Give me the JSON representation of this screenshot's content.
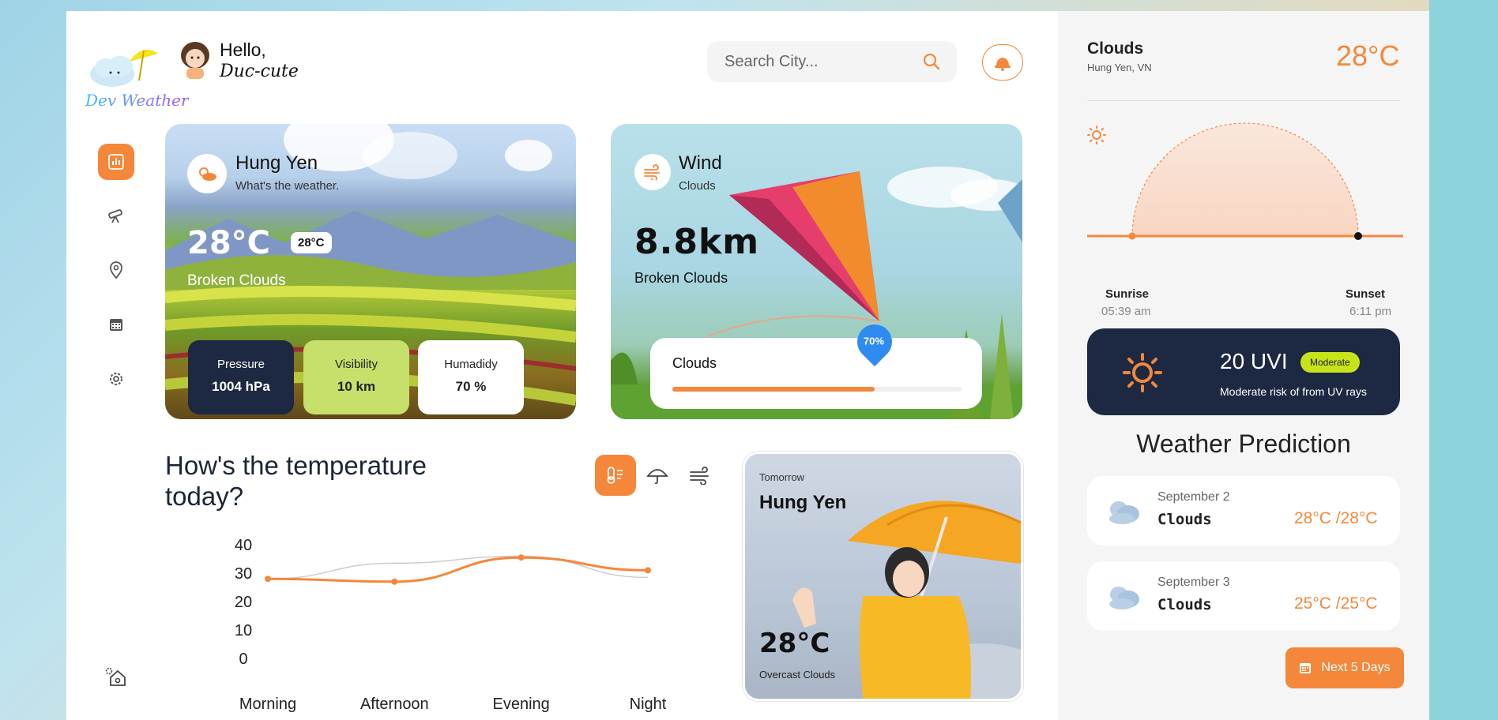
{
  "brand": {
    "logo_text": "Dev Weather"
  },
  "greeting": {
    "hello": "Hello,",
    "name": "Duc-cute"
  },
  "search": {
    "placeholder": "Search City..."
  },
  "colors": {
    "accent": "#f5873a",
    "navy": "#1d2942",
    "lime": "#c7df6b",
    "pin": "#2f8bf0"
  },
  "sidebar": {
    "items": [
      {
        "icon": "chart-icon",
        "active": true
      },
      {
        "icon": "telescope-icon",
        "active": false
      },
      {
        "icon": "location-pin-icon",
        "active": false
      },
      {
        "icon": "calendar-icon",
        "active": false
      },
      {
        "icon": "gear-icon",
        "active": false
      }
    ],
    "bottom_icon": "home-settings-icon"
  },
  "current": {
    "city": "Hung Yen",
    "subtitle": "What's the weather.",
    "temp": "28°C",
    "badge": "28°C",
    "description": "Broken Clouds",
    "stats": [
      {
        "label": "Pressure",
        "value": "1004 hPa"
      },
      {
        "label": "Visibility",
        "value": "10 km"
      },
      {
        "label": "Humadidy",
        "value": "70 %"
      }
    ]
  },
  "wind": {
    "title": "Wind",
    "subtitle": "Clouds",
    "value": "8.8km",
    "description": "Broken Clouds",
    "clouds_label": "Clouds",
    "clouds_percent": 70,
    "clouds_text": "70%"
  },
  "temperature": {
    "title": "How's the temperature today?",
    "modes": [
      "thermometer-icon",
      "umbrella-icon",
      "wind-icon"
    ],
    "active_mode": 0
  },
  "chart_data": {
    "type": "line",
    "categories": [
      "Morning",
      "Afternoon",
      "Evening",
      "Night"
    ],
    "series": [
      {
        "values": [
          28,
          27,
          35.5,
          31
        ],
        "color": "#f5873a"
      },
      {
        "values": [
          28,
          33.5,
          36,
          28.5
        ],
        "color": "#cccccc"
      }
    ],
    "yticks": [
      "40",
      "30",
      "20",
      "10",
      "0"
    ],
    "ylim": [
      0,
      40
    ],
    "grid": false
  },
  "tomorrow": {
    "label": "Tomorrow",
    "city": "Hung Yen",
    "temp": "28°C",
    "description": "Overcast Clouds"
  },
  "summary": {
    "condition": "Clouds",
    "location": "Hung Yen, VN",
    "temp": "28°C",
    "sunrise_label": "Sunrise",
    "sunrise_time": "05:39 am",
    "sunset_label": "Sunset",
    "sunset_time": "6:11 pm"
  },
  "uvi": {
    "value": "20 UVI",
    "badge": "Moderate",
    "text": "Moderate risk of from UV rays"
  },
  "prediction": {
    "title": "Weather Prediction",
    "items": [
      {
        "date": "September 2",
        "condition": "Clouds",
        "temps": "28°C /28°C"
      },
      {
        "date": "September 3",
        "condition": "Clouds",
        "temps": "25°C /25°C"
      }
    ],
    "next_label": "Next 5 Days"
  }
}
